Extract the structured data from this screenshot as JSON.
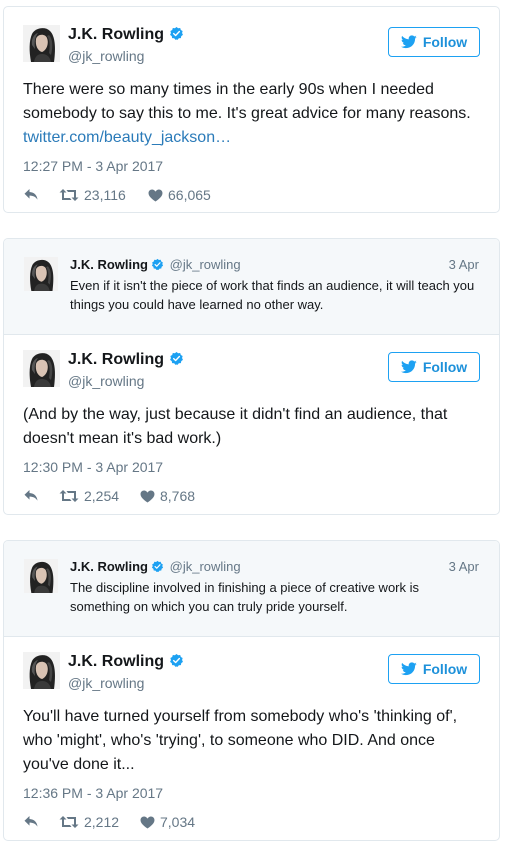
{
  "colors": {
    "accent": "#1da1f2",
    "muted": "#657786",
    "link": "#2b7bb9",
    "border": "#e1e8ed",
    "quote_bg": "#f5f8fa"
  },
  "icons": {
    "verified": "verified-badge-icon",
    "bird": "twitter-bird-icon",
    "reply": "reply-icon",
    "retweet": "retweet-icon",
    "like": "heart-icon"
  },
  "tweets": [
    {
      "name": "J.K. Rowling",
      "handle": "@jk_rowling",
      "follow_label": "Follow",
      "text": "There were so many times in the early 90s when I needed somebody to say this to me. It's great advice for many reasons.",
      "link": "twitter.com/beauty_jackson…",
      "time": "12:27 PM - 3 Apr 2017",
      "retweets": "23,116",
      "likes": "66,065"
    },
    {
      "quote": {
        "name": "J.K. Rowling",
        "handle": "@jk_rowling",
        "date": "3 Apr",
        "text": "Even if it isn't the piece of work that finds an audience, it will teach you things you could have learned no other way."
      },
      "name": "J.K. Rowling",
      "handle": "@jk_rowling",
      "follow_label": "Follow",
      "text": "(And by the way, just because it didn't find an audience, that doesn't mean it's bad work.)",
      "time": "12:30 PM - 3 Apr 2017",
      "retweets": "2,254",
      "likes": "8,768"
    },
    {
      "quote": {
        "name": "J.K. Rowling",
        "handle": "@jk_rowling",
        "date": "3 Apr",
        "text": "The discipline involved in finishing a piece of creative work is something on which you can truly pride yourself."
      },
      "name": "J.K. Rowling",
      "handle": "@jk_rowling",
      "follow_label": "Follow",
      "text": "You'll have turned yourself from somebody who's 'thinking of', who 'might', who's 'trying', to someone who DID. And once you've done it...",
      "time": "12:36 PM - 3 Apr 2017",
      "retweets": "2,212",
      "likes": "7,034"
    }
  ]
}
